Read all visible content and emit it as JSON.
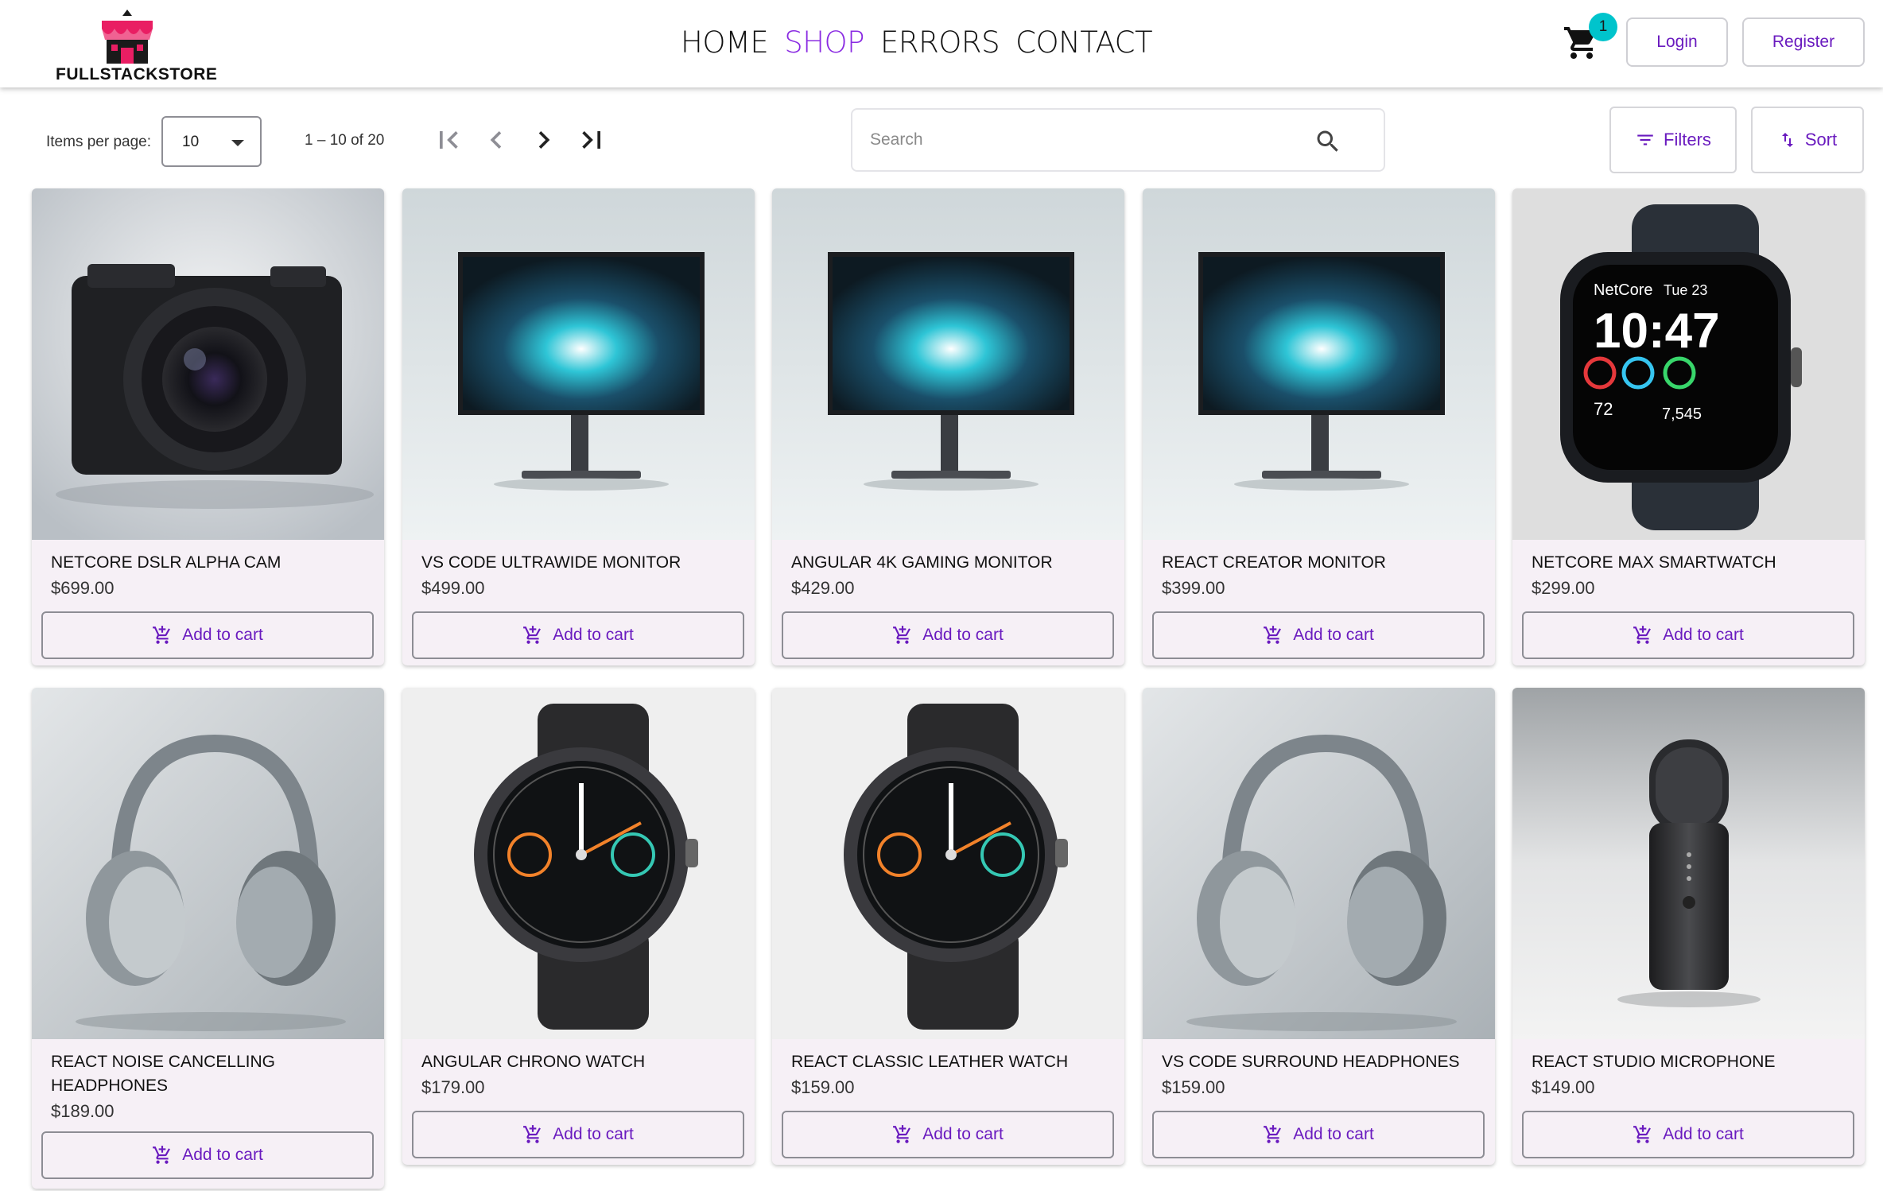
{
  "brand": {
    "name": "FULLSTACKSTORE"
  },
  "nav": [
    {
      "label": "HOME",
      "active": false
    },
    {
      "label": "SHOP",
      "active": true
    },
    {
      "label": "ERRORS",
      "active": false
    },
    {
      "label": "CONTACT",
      "active": false
    }
  ],
  "cart": {
    "count": "1"
  },
  "auth": {
    "login": "Login",
    "register": "Register"
  },
  "paginator": {
    "items_per_page_label": "Items per page:",
    "items_per_page_value": "10",
    "range": "1 – 10 of 20"
  },
  "search": {
    "placeholder": "Search"
  },
  "tools": {
    "filters": "Filters",
    "sort": "Sort"
  },
  "add_to_cart_label": "Add to cart",
  "products": [
    {
      "name": "NETCORE DSLR ALPHA CAM",
      "price": "$699.00",
      "image": "camera"
    },
    {
      "name": "VS CODE ULTRAWIDE MONITOR",
      "price": "$499.00",
      "image": "monitor"
    },
    {
      "name": "ANGULAR 4K GAMING MONITOR",
      "price": "$429.00",
      "image": "monitor"
    },
    {
      "name": "REACT CREATOR MONITOR",
      "price": "$399.00",
      "image": "monitor"
    },
    {
      "name": "NETCORE MAX SMARTWATCH",
      "price": "$299.00",
      "image": "smartwatch"
    },
    {
      "name": "REACT NOISE CANCELLING HEADPHONES",
      "price": "$189.00",
      "image": "headphones"
    },
    {
      "name": "ANGULAR CHRONO WATCH",
      "price": "$179.00",
      "image": "watch"
    },
    {
      "name": "REACT CLASSIC LEATHER WATCH",
      "price": "$159.00",
      "image": "watch"
    },
    {
      "name": "VS CODE SURROUND HEADPHONES",
      "price": "$159.00",
      "image": "headphones"
    },
    {
      "name": "REACT STUDIO MICROPHONE",
      "price": "$149.00",
      "image": "microphone"
    }
  ],
  "watch_face": {
    "brand": "NetCore",
    "date": "Tue 23",
    "time": "10:47",
    "hr": "72",
    "steps": "7,545"
  },
  "colors": {
    "accent": "#8a2be2",
    "button_text": "#6a1bbf",
    "badge": "#00c4cc",
    "card_bg": "#f6f0f6"
  }
}
